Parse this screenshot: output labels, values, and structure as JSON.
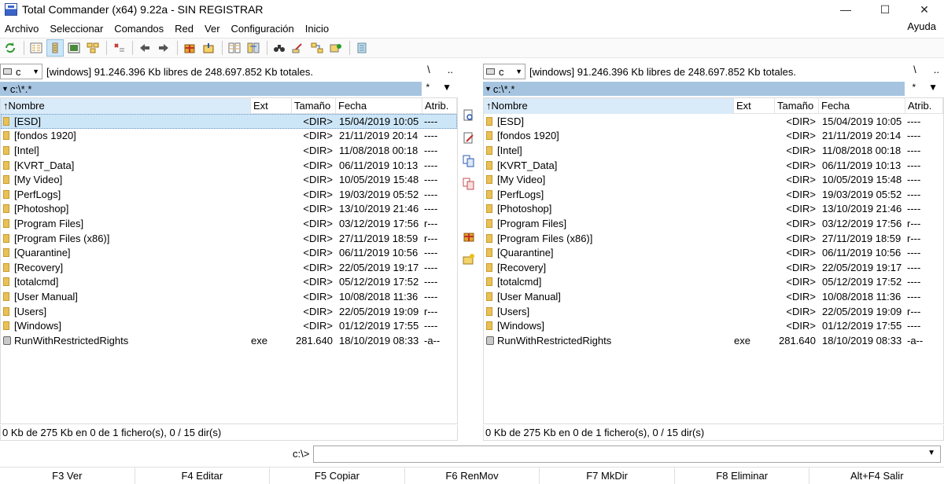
{
  "window": {
    "title": "Total Commander (x64) 9.22a - SIN REGISTRAR",
    "minimize": "—",
    "maximize": "☐",
    "close": "✕"
  },
  "menu": {
    "items": [
      "Archivo",
      "Seleccionar",
      "Comandos",
      "Red",
      "Ver",
      "Configuración",
      "Inicio"
    ],
    "help": "Ayuda"
  },
  "toolbar": {
    "icons": [
      "refresh-icon",
      "brief-view-icon",
      "full-view-icon",
      "thumbnails-icon",
      "tree-view-icon",
      "invert-selection-icon",
      "back-icon",
      "forward-icon",
      "pack-icon",
      "unpack-icon",
      "compare-files-icon",
      "compare-dirs-icon",
      "find-icon",
      "rename-icon",
      "sync-dirs-icon",
      "ftp-icon",
      "notepad-icon"
    ]
  },
  "left_panel": {
    "drive": "c",
    "drive_info": "[windows]  91.246.396 Kb libres de 248.697.852 Kb totales.",
    "nav_root": "\\",
    "nav_up": "..",
    "path": "c:\\*.*",
    "filter": "*",
    "columns": {
      "name": "↑Nombre",
      "ext": "Ext",
      "size": "Tamaño",
      "date": "Fecha",
      "attr": "Atrib."
    },
    "status": "0 Kb de 275 Kb en 0 de 1 fichero(s), 0 / 15 dir(s)"
  },
  "right_panel": {
    "drive": "c",
    "drive_info": "[windows]  91.246.396 Kb libres de 248.697.852 Kb totales.",
    "nav_root": "\\",
    "nav_up": "..",
    "path": "c:\\*.*",
    "filter": "*",
    "columns": {
      "name": "↑Nombre",
      "ext": "Ext",
      "size": "Tamaño",
      "date": "Fecha",
      "attr": "Atrib."
    },
    "status": "0 Kb de 275 Kb en 0 de 1 fichero(s), 0 / 15 dir(s)"
  },
  "files": [
    {
      "name": "[ESD]",
      "ext": "",
      "size": "<DIR>",
      "date": "15/04/2019 10:05",
      "attr": "----",
      "type": "dir"
    },
    {
      "name": "[fondos 1920]",
      "ext": "",
      "size": "<DIR>",
      "date": "21/11/2019 20:14",
      "attr": "----",
      "type": "dir"
    },
    {
      "name": "[Intel]",
      "ext": "",
      "size": "<DIR>",
      "date": "11/08/2018 00:18",
      "attr": "----",
      "type": "dir"
    },
    {
      "name": "[KVRT_Data]",
      "ext": "",
      "size": "<DIR>",
      "date": "06/11/2019 10:13",
      "attr": "----",
      "type": "dir"
    },
    {
      "name": "[My Video]",
      "ext": "",
      "size": "<DIR>",
      "date": "10/05/2019 15:48",
      "attr": "----",
      "type": "dir"
    },
    {
      "name": "[PerfLogs]",
      "ext": "",
      "size": "<DIR>",
      "date": "19/03/2019 05:52",
      "attr": "----",
      "type": "dir"
    },
    {
      "name": "[Photoshop]",
      "ext": "",
      "size": "<DIR>",
      "date": "13/10/2019 21:46",
      "attr": "----",
      "type": "dir"
    },
    {
      "name": "[Program Files]",
      "ext": "",
      "size": "<DIR>",
      "date": "03/12/2019 17:56",
      "attr": "r---",
      "type": "dir"
    },
    {
      "name": "[Program Files (x86)]",
      "ext": "",
      "size": "<DIR>",
      "date": "27/11/2019 18:59",
      "attr": "r---",
      "type": "dir"
    },
    {
      "name": "[Quarantine]",
      "ext": "",
      "size": "<DIR>",
      "date": "06/11/2019 10:56",
      "attr": "----",
      "type": "dir"
    },
    {
      "name": "[Recovery]",
      "ext": "",
      "size": "<DIR>",
      "date": "22/05/2019 19:17",
      "attr": "----",
      "type": "dir"
    },
    {
      "name": "[totalcmd]",
      "ext": "",
      "size": "<DIR>",
      "date": "05/12/2019 17:52",
      "attr": "----",
      "type": "dir"
    },
    {
      "name": "[User Manual]",
      "ext": "",
      "size": "<DIR>",
      "date": "10/08/2018 11:36",
      "attr": "----",
      "type": "dir"
    },
    {
      "name": "[Users]",
      "ext": "",
      "size": "<DIR>",
      "date": "22/05/2019 19:09",
      "attr": "r---",
      "type": "dir"
    },
    {
      "name": "[Windows]",
      "ext": "",
      "size": "<DIR>",
      "date": "01/12/2019 17:55",
      "attr": "----",
      "type": "dir"
    },
    {
      "name": "RunWithRestrictedRights",
      "ext": "exe",
      "size": "281.640",
      "date": "18/10/2019 08:33",
      "attr": "-a--",
      "type": "file"
    }
  ],
  "middle_toolbar": [
    "view-file-icon",
    "edit-file-icon",
    "copy-icon",
    "move-icon",
    "pack-files-icon",
    "new-folder-icon"
  ],
  "command_line": {
    "prompt": "c:\\>",
    "value": ""
  },
  "function_keys": [
    "F3 Ver",
    "F4 Editar",
    "F5 Copiar",
    "F6 RenMov",
    "F7 MkDir",
    "F8 Eliminar",
    "Alt+F4 Salir"
  ]
}
